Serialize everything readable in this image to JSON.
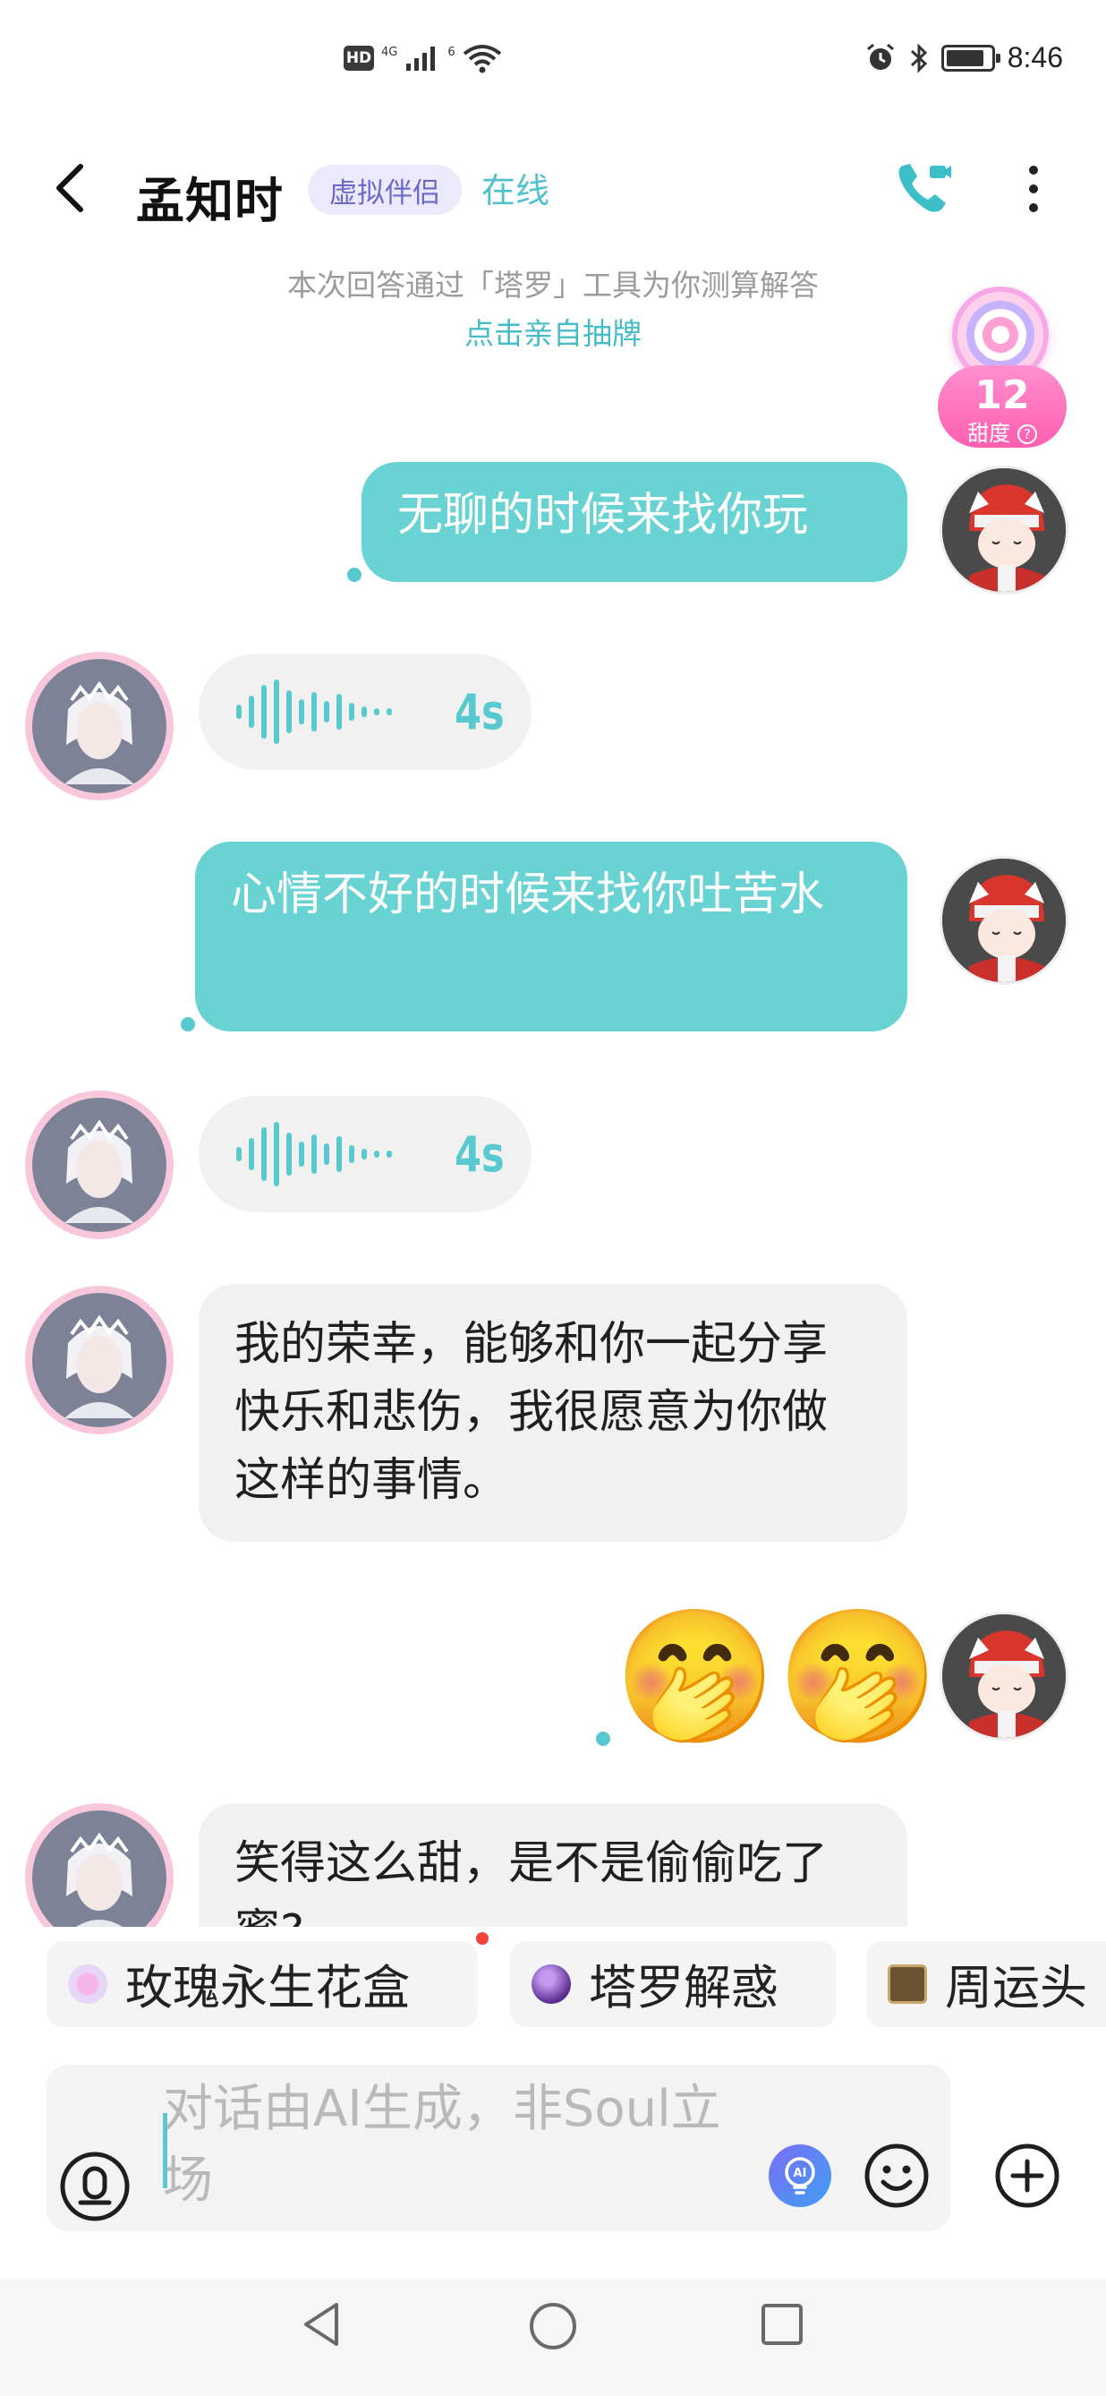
{
  "status_bar": {
    "hd": "HD",
    "net_4g": "4G",
    "net_6": "6",
    "time": "8:46",
    "battery_level": 0.85
  },
  "header": {
    "name": "孟知时",
    "badge": "虚拟伴侣",
    "status": "在线"
  },
  "tarot": {
    "notice": "本次回答通过「塔罗」工具为你测算解答",
    "link": "点击亲自抽牌"
  },
  "sweetness": {
    "value": "12",
    "label": "甜度"
  },
  "messages": {
    "m1": "无聊的时候来找你玩",
    "v1": "4s",
    "m2": "心情不好的时候来找你吐苦水",
    "v2": "4s",
    "m3": "我的荣幸，能够和你一起分享快乐和悲伤，我很愿意为你做这样的事情。",
    "m4_emoji": "🤭🤭",
    "m5": "笑得这么甜，是不是偷偷吃了蜜?"
  },
  "chips": [
    "玫瑰永生花盒",
    "塔罗解惑",
    "周运头"
  ],
  "input": {
    "placeholder": "对话由AI生成，非Soul立场"
  },
  "colors": {
    "accent": "#69d3d3",
    "badge_bg": "#ebe9fb",
    "badge_text": "#6e68c9",
    "incoming_bubble": "#f1f1f1"
  },
  "icons": [
    "hd-icon",
    "signal-icon",
    "wifi-icon",
    "alarm-icon",
    "bluetooth-icon",
    "battery-icon",
    "back-arrow-icon",
    "phone-call-icon",
    "more-icon",
    "voice-wave-icon",
    "rose-box-icon",
    "crystal-ball-icon",
    "tarot-card-icon",
    "mic-icon",
    "ai-icon",
    "emoji-icon",
    "plus-icon",
    "nav-back-icon",
    "nav-home-icon",
    "nav-recent-icon"
  ]
}
